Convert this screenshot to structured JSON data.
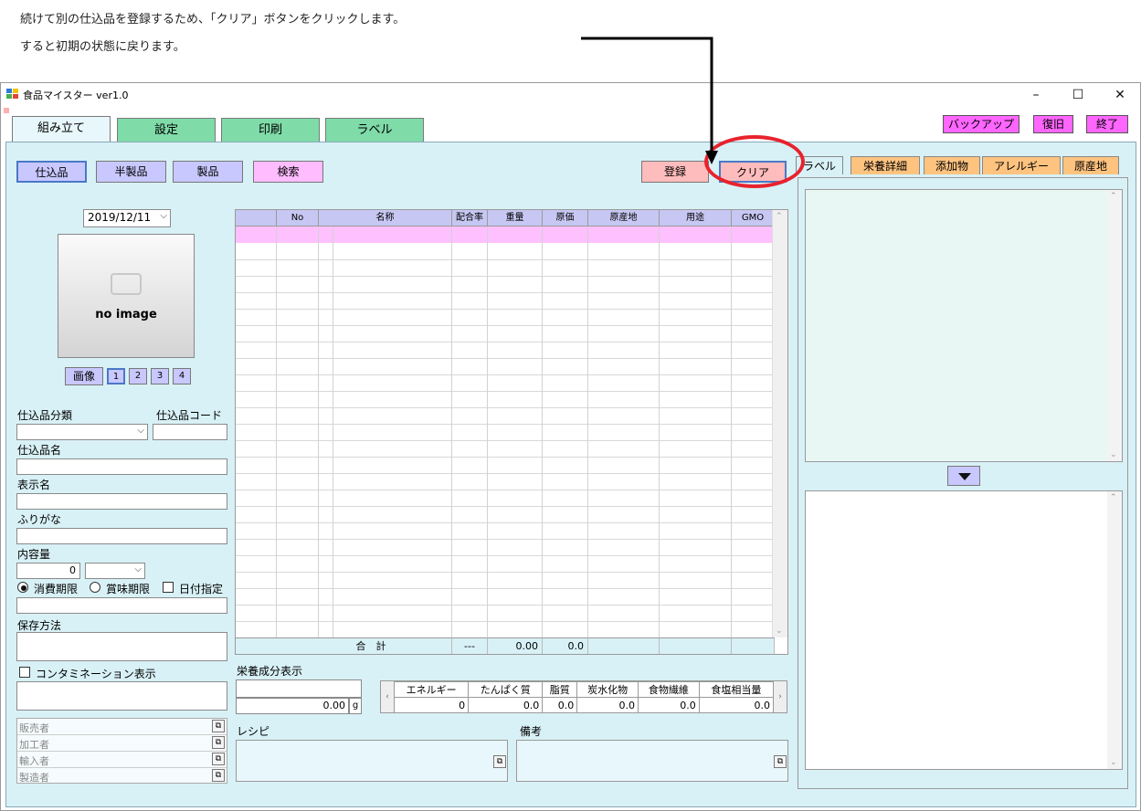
{
  "instructions": {
    "line1": "続けて別の仕込品を登録するため、「クリア」ボタンをクリックします。",
    "line2": "すると初期の状態に戻ります。"
  },
  "window": {
    "title": "食品マイスター ver1.0",
    "minimize": "–",
    "maximize": "☐",
    "close": "✕"
  },
  "main_tabs": [
    "組み立て",
    "設定",
    "印刷",
    "ラベル"
  ],
  "top_buttons": {
    "backup": "バックアップ",
    "restore": "復旧",
    "exit": "終了"
  },
  "category_buttons": [
    "仕込品",
    "半製品",
    "製品",
    "検索"
  ],
  "action_buttons": {
    "register": "登録",
    "clear": "クリア"
  },
  "date": "2019/12/11",
  "image": {
    "placeholder": "no image",
    "button": "画像",
    "pages": [
      "1",
      "2",
      "3",
      "4"
    ]
  },
  "form": {
    "category_label": "仕込品分類",
    "code_label": "仕込品コード",
    "name_label": "仕込品名",
    "display_name_label": "表示名",
    "furigana_label": "ふりがな",
    "content_label": "内容量",
    "content_value": "0",
    "radio_consume": "消費期限",
    "radio_best": "賞味期限",
    "check_date": "日付指定",
    "storage_label": "保存方法",
    "contamination_label": "コンタミネーション表示",
    "parties": [
      "販売者",
      "加工者",
      "輸入者",
      "製造者"
    ]
  },
  "grid": {
    "headers": [
      "",
      "No",
      "名称",
      "配合率",
      "重量",
      "原価",
      "原産地",
      "用途",
      "GMO"
    ],
    "footer_label": "合　計",
    "footer_rate": "---",
    "footer_weight": "0.00",
    "footer_cost": "0.0"
  },
  "nutrition": {
    "label": "栄養成分表示",
    "amount": "0.00",
    "unit": "g",
    "headers": [
      "エネルギー",
      "たんぱく質",
      "脂質",
      "炭水化物",
      "食物繊維",
      "食塩相当量"
    ],
    "values": [
      "0",
      "0.0",
      "0.0",
      "0.0",
      "0.0",
      "0.0"
    ]
  },
  "recipe_label": "レシピ",
  "notes_label": "備考",
  "right_tabs": [
    "ラベル",
    "栄養詳細",
    "添加物",
    "アレルギー",
    "原産地"
  ],
  "colors": {
    "highlight": "#e8232d",
    "panel": "#d8f1f6",
    "tab_green": "#7fdba8"
  }
}
